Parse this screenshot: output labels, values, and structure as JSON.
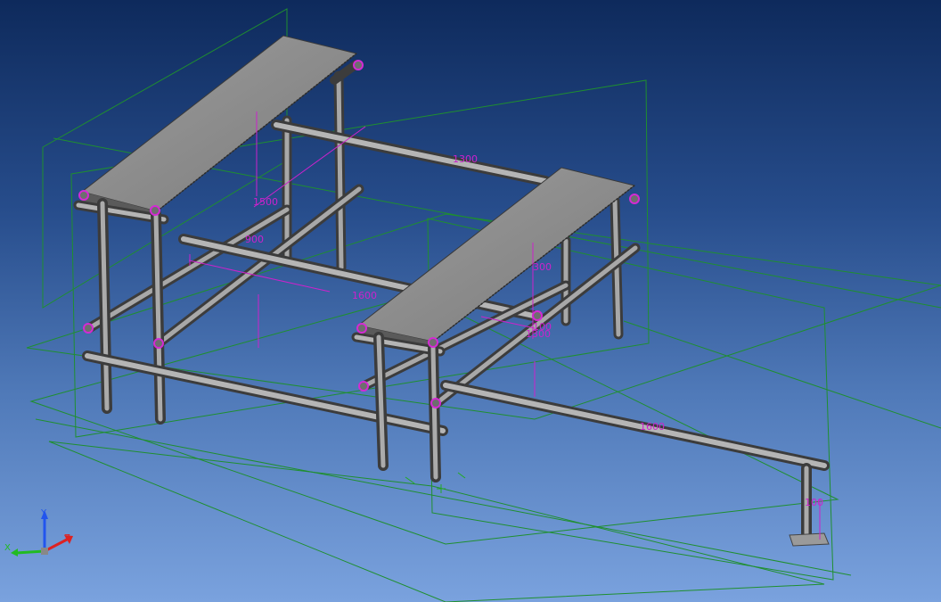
{
  "dimensions": {
    "d1": "1500",
    "d2": "900",
    "d3": "1600",
    "d4": "1300",
    "d5": "300",
    "d6": "1300",
    "d7": "100",
    "d8": "1600",
    "d9": "100"
  },
  "triad": {
    "x": "X",
    "y": "Y",
    "z": "Z"
  },
  "colors": {
    "pipe": "#8c8c8c",
    "platform": "#8a8a8a",
    "dimension": "#cc22cc",
    "sketch_lines": "#1f8f2f"
  }
}
